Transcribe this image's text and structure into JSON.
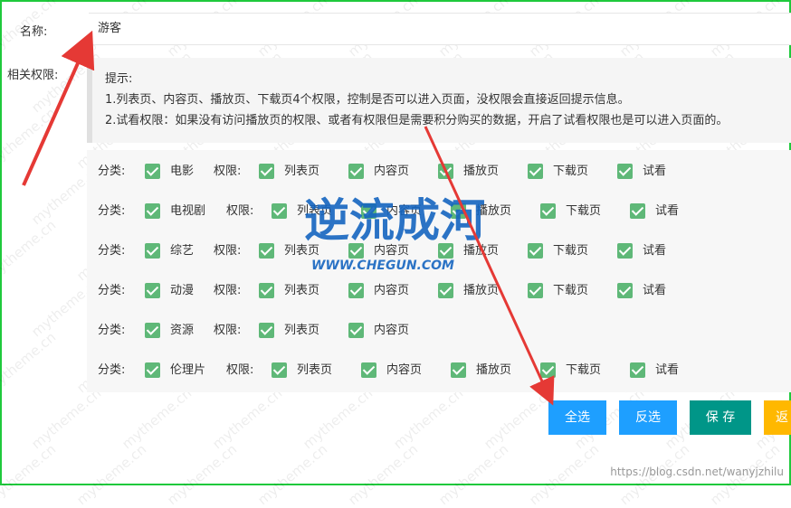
{
  "form": {
    "name_label": "名称:",
    "name_value": "游客",
    "perm_label": "相关权限:"
  },
  "tip": {
    "title": "提示:",
    "line1": "1.列表页、内容页、播放页、下载页4个权限，控制是否可以进入页面，没权限会直接返回提示信息。",
    "line2": "2.试看权限：如果没有访问播放页的权限、或者有权限但是需要积分购买的数据，开启了试看权限也是可以进入页面的。"
  },
  "permissions": {
    "category_label": "分类:",
    "perm_label": "权限:",
    "rows": [
      {
        "category": "电影",
        "perms": [
          "列表页",
          "内容页",
          "播放页",
          "下载页",
          "试看"
        ]
      },
      {
        "category": "电视剧",
        "perms": [
          "列表页",
          "内容页",
          "播放页",
          "下载页",
          "试看"
        ]
      },
      {
        "category": "综艺",
        "perms": [
          "列表页",
          "内容页",
          "播放页",
          "下载页",
          "试看"
        ]
      },
      {
        "category": "动漫",
        "perms": [
          "列表页",
          "内容页",
          "播放页",
          "下载页",
          "试看"
        ]
      },
      {
        "category": "资源",
        "perms": [
          "列表页",
          "内容页"
        ]
      },
      {
        "category": "伦理片",
        "perms": [
          "列表页",
          "内容页",
          "播放页",
          "下载页",
          "试看"
        ]
      }
    ]
  },
  "buttons": {
    "select_all": "全选",
    "invert": "反选",
    "save": "保 存",
    "fourth": "返"
  },
  "overlay": {
    "logo_main": "逆流成河",
    "logo_sub": "WWW.CHEGUN.COM",
    "watermark": "mytheme.cn",
    "credit": "https://blog.csdn.net/wanyjzhilu"
  },
  "colors": {
    "checkbox": "#5fb878",
    "button_blue": "#1e9fff",
    "button_green": "#009688",
    "button_orange": "#ffb800",
    "frame": "#1fc93c",
    "arrow": "#e53935"
  }
}
